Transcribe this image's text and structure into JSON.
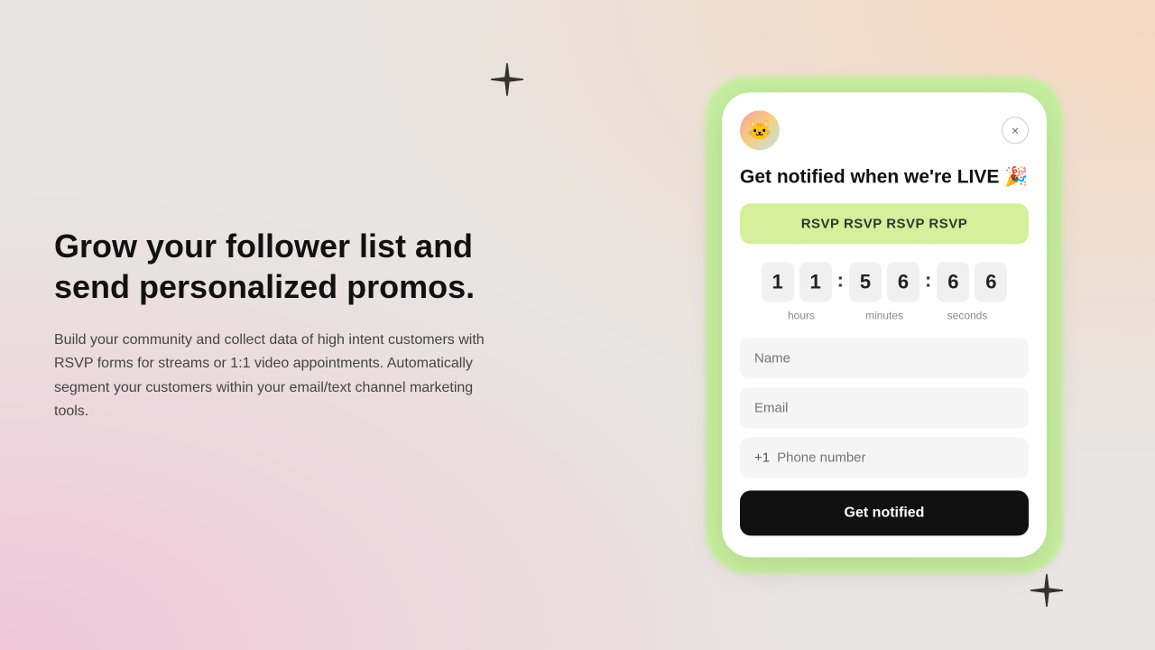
{
  "background": {
    "color": "#e8e5e2"
  },
  "left": {
    "heading": "Grow your follower list and send personalized promos.",
    "body": "Build your community and collect data of high intent customers with RSVP forms for streams or 1:1 video appointments. Automatically segment your customers within your email/text channel marketing tools."
  },
  "phone": {
    "avatar_emoji": "🐱",
    "close_label": "×",
    "title": "Get notified when we're LIVE 🎉",
    "rsvp_button": "RSVP RSVP RSVP RSVP",
    "countdown": {
      "digits": [
        "1",
        "1",
        "5",
        "6",
        "6",
        "6"
      ],
      "separators": [
        ":",
        ":"
      ],
      "hours_label": "hours",
      "minutes_label": "minutes",
      "seconds_label": "seconds"
    },
    "name_placeholder": "Name",
    "email_placeholder": "Email",
    "country_code": "+1",
    "phone_placeholder": "Phone number",
    "notify_button": "Get notified"
  },
  "stars": {
    "top_char": "✦",
    "bottom_char": "✦"
  }
}
